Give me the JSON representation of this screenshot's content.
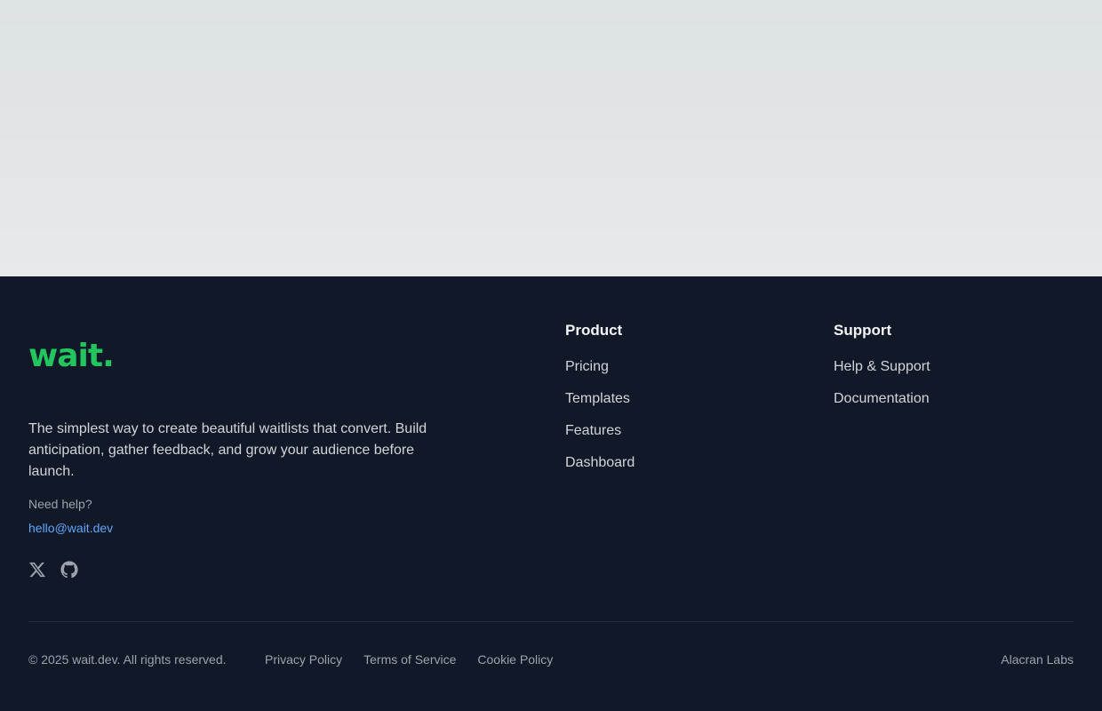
{
  "brand": {
    "logo_text": "wait.",
    "tagline": "The simplest way to create beautiful waitlists that convert. Build anticipation, gather feedback, and grow your audience before launch.",
    "accent_color": "#22c55e"
  },
  "help": {
    "label": "Need help?",
    "email": "hello@wait.dev"
  },
  "socials": [
    {
      "icon": "x-icon"
    },
    {
      "icon": "github-icon"
    }
  ],
  "columns": {
    "product": {
      "title": "Product",
      "links": [
        "Pricing",
        "Templates",
        "Features",
        "Dashboard"
      ]
    },
    "support": {
      "title": "Support",
      "links": [
        "Help & Support",
        "Documentation"
      ]
    }
  },
  "bottom": {
    "copyright": "© 2025 wait.dev. All rights reserved.",
    "legal_links": [
      "Privacy Policy",
      "Terms of Service",
      "Cookie Policy"
    ],
    "credit": "Alacran Labs"
  }
}
